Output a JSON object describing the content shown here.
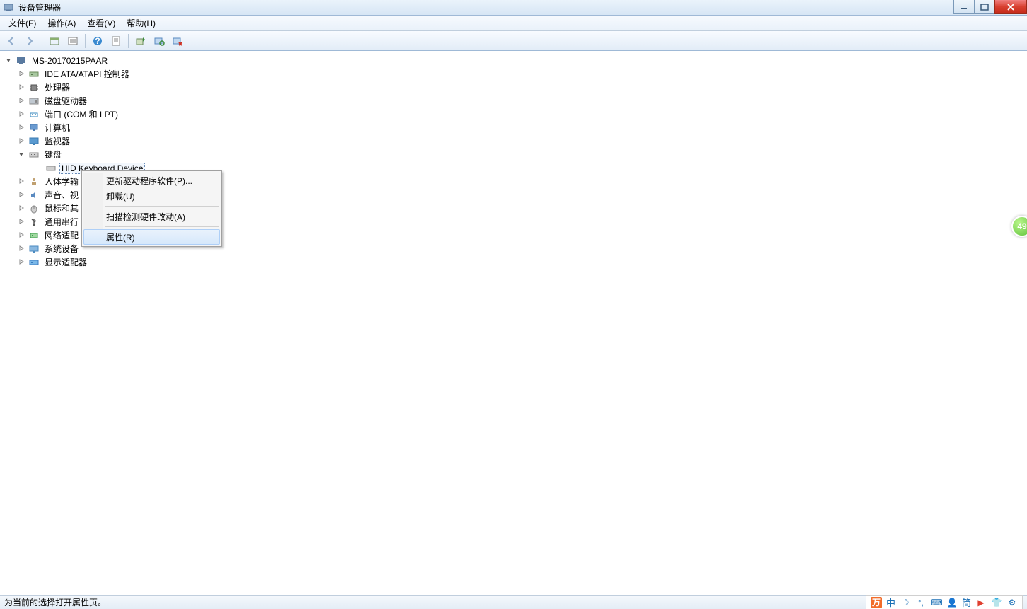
{
  "window": {
    "title": "设备管理器"
  },
  "menubar": {
    "file": "文件(F)",
    "action": "操作(A)",
    "view": "查看(V)",
    "help": "帮助(H)"
  },
  "tree": {
    "root": "MS-20170215PAAR",
    "nodes": {
      "ide": "IDE ATA/ATAPI 控制器",
      "cpu": "处理器",
      "disk": "磁盘驱动器",
      "ports": "端口 (COM 和 LPT)",
      "computer": "计算机",
      "monitor": "监视器",
      "keyboard": "键盘",
      "keyboard_child": "HID Keyboard Device",
      "hid": "人体学输",
      "sound": "声音、视",
      "mouse": "鼠标和其",
      "usb": "通用串行",
      "network": "网络适配",
      "system": "系统设备",
      "display": "显示适配器"
    }
  },
  "context_menu": {
    "update_driver": "更新驱动程序软件(P)...",
    "uninstall": "卸载(U)",
    "scan": "扫描检测硬件改动(A)",
    "properties": "属性(R)"
  },
  "statusbar": {
    "text": "为当前的选择打开属性页。"
  },
  "ime": {
    "lang": "中",
    "mode": "简"
  },
  "badge": {
    "text": "49"
  }
}
